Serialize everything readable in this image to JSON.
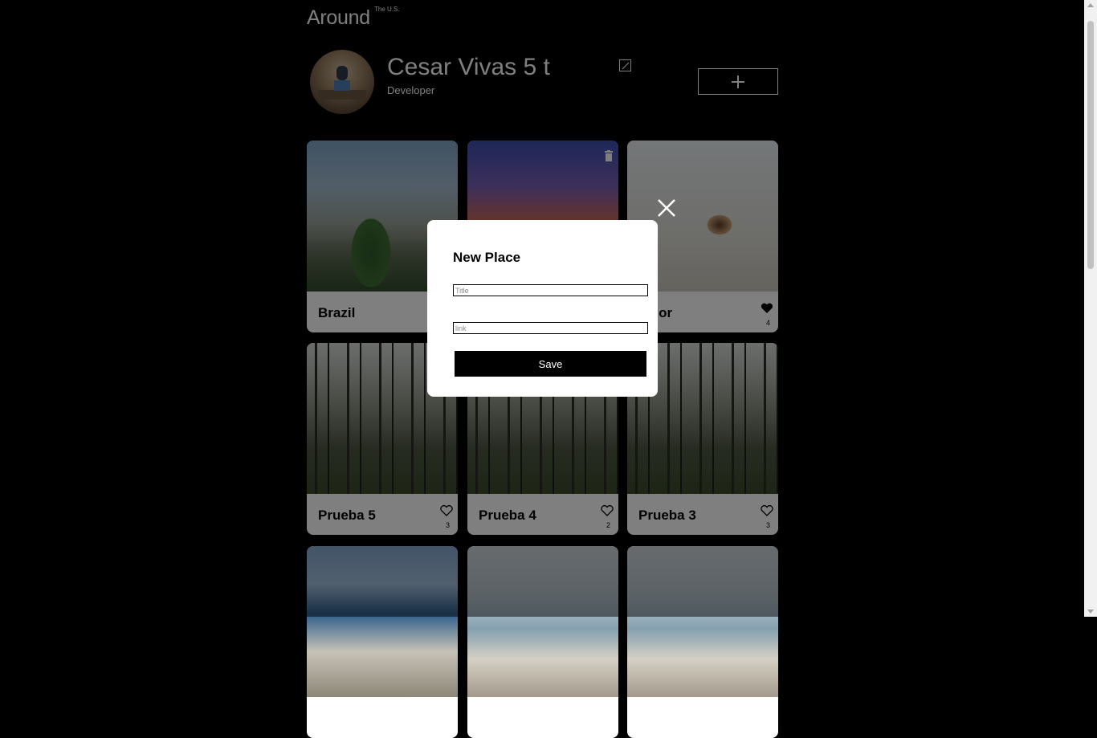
{
  "header": {
    "logo": "Around",
    "logo_superscript": "The U.S."
  },
  "profile": {
    "name": "Cesar Vivas 5 t",
    "about": "Developer",
    "edit_icon": "pencil-icon",
    "add_icon": "plus-icon"
  },
  "cards": [
    {
      "title": "Brazil",
      "likes": ""
    },
    {
      "title": "",
      "likes": ""
    },
    {
      "title": "nior",
      "likes": "4"
    },
    {
      "title": "Prueba 5",
      "likes": "3"
    },
    {
      "title": "Prueba 4",
      "likes": "2"
    },
    {
      "title": "Prueba 3",
      "likes": "3"
    }
  ],
  "modal": {
    "title": "New Place",
    "title_placeholder": "Title",
    "link_placeholder": "link",
    "save_label": "Save"
  },
  "colors": {
    "background": "#000000",
    "surface": "#ffffff",
    "text": "#000000"
  }
}
